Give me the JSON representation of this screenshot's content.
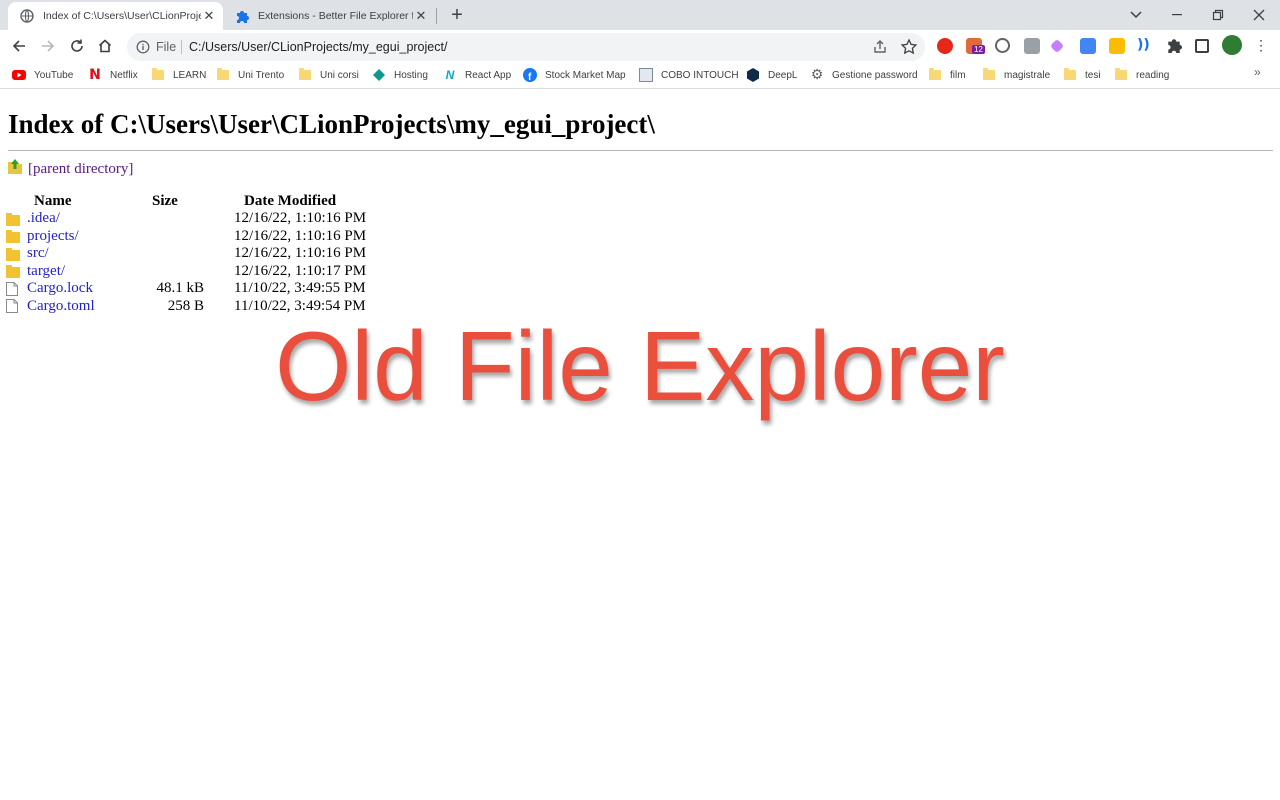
{
  "browser": {
    "tabs": [
      {
        "title": "Index of C:\\Users\\User\\CLionProjects\\my_egui_project\\",
        "active": true
      },
      {
        "title": "Extensions - Better File Explorer for Chrome",
        "active": false
      }
    ],
    "new_tab_symbol": "+",
    "address": {
      "scheme_label": "File",
      "url": "C:/Users/User/CLionProjects/my_egui_project/"
    },
    "extension_badge": "12",
    "bookmarks": [
      {
        "label": "YouTube",
        "icon": "youtube-icon"
      },
      {
        "label": "Netflix",
        "icon": "netflix-icon"
      },
      {
        "label": "LEARN",
        "icon": "folder-icon"
      },
      {
        "label": "Uni Trento",
        "icon": "folder-icon"
      },
      {
        "label": "Uni corsi",
        "icon": "folder-icon"
      },
      {
        "label": "Hosting",
        "icon": "hosting-icon"
      },
      {
        "label": "React App",
        "icon": "react-icon"
      },
      {
        "label": "Stock Market Map",
        "icon": "facebook-icon"
      },
      {
        "label": "COBO INTOUCH",
        "icon": "cobo-icon"
      },
      {
        "label": "DeepL",
        "icon": "deepl-icon"
      },
      {
        "label": "Gestione password",
        "icon": "gear-icon"
      },
      {
        "label": "film",
        "icon": "folder-icon"
      },
      {
        "label": "magistrale",
        "icon": "folder-icon"
      },
      {
        "label": "tesi",
        "icon": "folder-icon"
      },
      {
        "label": "reading",
        "icon": "folder-icon"
      }
    ],
    "bookmarks_overflow": "»"
  },
  "page": {
    "title": "Index of C:\\Users\\User\\CLionProjects\\my_egui_project\\",
    "parent_link": "[parent directory]",
    "columns": {
      "name": "Name",
      "size": "Size",
      "date": "Date Modified"
    },
    "entries": [
      {
        "name": ".idea/",
        "size": "",
        "date": "12/16/22, 1:10:16 PM",
        "type": "folder"
      },
      {
        "name": "projects/",
        "size": "",
        "date": "12/16/22, 1:10:16 PM",
        "type": "folder"
      },
      {
        "name": "src/",
        "size": "",
        "date": "12/16/22, 1:10:16 PM",
        "type": "folder"
      },
      {
        "name": "target/",
        "size": "",
        "date": "12/16/22, 1:10:17 PM",
        "type": "folder"
      },
      {
        "name": "Cargo.lock",
        "size": "48.1 kB",
        "date": "11/10/22, 3:49:55 PM",
        "type": "file"
      },
      {
        "name": "Cargo.toml",
        "size": "258 B",
        "date": "11/10/22, 3:49:54 PM",
        "type": "file"
      }
    ]
  },
  "overlay": {
    "caption": "Old File Explorer",
    "color": "#ea4f3d"
  }
}
